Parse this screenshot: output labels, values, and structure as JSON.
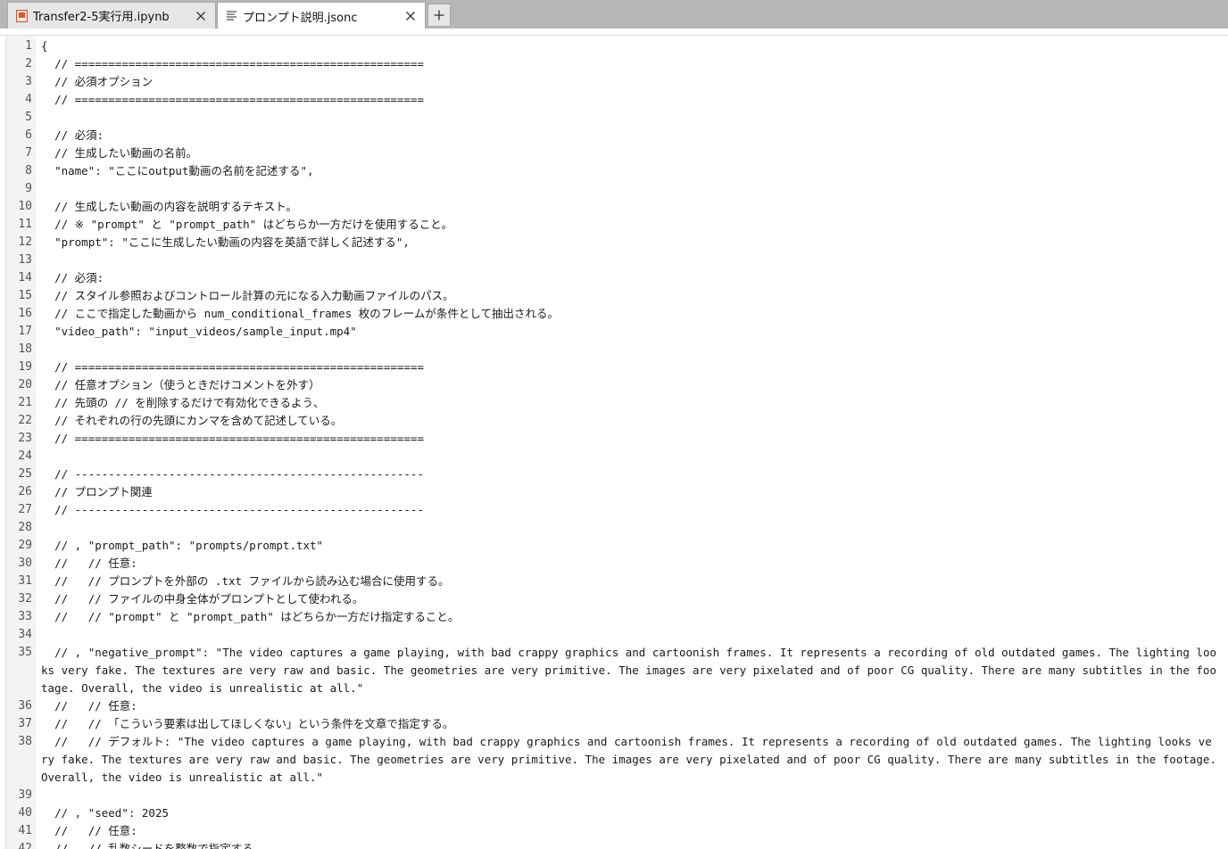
{
  "tabs": [
    {
      "label": "Transfer2-5実行用.ipynb",
      "icon": "notebook-icon",
      "active": false
    },
    {
      "label": "プロンプト説明.jsonc",
      "icon": "text-file-icon",
      "active": true
    }
  ],
  "add_tab_label": "+",
  "close_glyph": "✕",
  "colors": {
    "notebook_icon": "#e8542c",
    "tabbar_bg": "#b7b7b7",
    "gutter_bg": "#f3f3f3"
  },
  "editor": {
    "lines": [
      {
        "n": "1",
        "text": "{"
      },
      {
        "n": "2",
        "text": "  // ===================================================="
      },
      {
        "n": "3",
        "text": "  // 必須オプション"
      },
      {
        "n": "4",
        "text": "  // ===================================================="
      },
      {
        "n": "5",
        "text": ""
      },
      {
        "n": "6",
        "text": "  // 必須:"
      },
      {
        "n": "7",
        "text": "  // 生成したい動画の名前。"
      },
      {
        "n": "8",
        "text": "  \"name\": \"ここにoutput動画の名前を記述する\","
      },
      {
        "n": "9",
        "text": ""
      },
      {
        "n": "10",
        "text": "  // 生成したい動画の内容を説明するテキスト。"
      },
      {
        "n": "11",
        "text": "  // ※ \"prompt\" と \"prompt_path\" はどちらか一方だけを使用すること。"
      },
      {
        "n": "12",
        "text": "  \"prompt\": \"ここに生成したい動画の内容を英語で詳しく記述する\","
      },
      {
        "n": "13",
        "text": ""
      },
      {
        "n": "14",
        "text": "  // 必須:"
      },
      {
        "n": "15",
        "text": "  // スタイル参照およびコントロール計算の元になる入力動画ファイルのパス。"
      },
      {
        "n": "16",
        "text": "  // ここで指定した動画から num_conditional_frames 枚のフレームが条件として抽出される。"
      },
      {
        "n": "17",
        "text": "  \"video_path\": \"input_videos/sample_input.mp4\""
      },
      {
        "n": "18",
        "text": ""
      },
      {
        "n": "19",
        "text": "  // ===================================================="
      },
      {
        "n": "20",
        "text": "  // 任意オプション（使うときだけコメントを外す）"
      },
      {
        "n": "21",
        "text": "  // 先頭の // を削除するだけで有効化できるよう、"
      },
      {
        "n": "22",
        "text": "  // それぞれの行の先頭にカンマを含めて記述している。"
      },
      {
        "n": "23",
        "text": "  // ===================================================="
      },
      {
        "n": "24",
        "text": ""
      },
      {
        "n": "25",
        "text": "  // ----------------------------------------------------"
      },
      {
        "n": "26",
        "text": "  // プロンプト関連"
      },
      {
        "n": "27",
        "text": "  // ----------------------------------------------------"
      },
      {
        "n": "28",
        "text": ""
      },
      {
        "n": "29",
        "text": "  // , \"prompt_path\": \"prompts/prompt.txt\""
      },
      {
        "n": "30",
        "text": "  //   // 任意:"
      },
      {
        "n": "31",
        "text": "  //   // プロンプトを外部の .txt ファイルから読み込む場合に使用する。"
      },
      {
        "n": "32",
        "text": "  //   // ファイルの中身全体がプロンプトとして使われる。"
      },
      {
        "n": "33",
        "text": "  //   // \"prompt\" と \"prompt_path\" はどちらか一方だけ指定すること。"
      },
      {
        "n": "34",
        "text": ""
      },
      {
        "n": "35",
        "text": "  // , \"negative_prompt\": \"The video captures a game playing, with bad crappy graphics and cartoonish frames. It represents a recording of old outdated games. The lighting looks very fake. The textures are very raw and basic. The geometries are very primitive. The images are very pixelated and of poor CG quality. There are many subtitles in the footage. Overall, the video is unrealistic at all.\""
      },
      {
        "n": "36",
        "text": "  //   // 任意:"
      },
      {
        "n": "37",
        "text": "  //   // 「こういう要素は出してほしくない」という条件を文章で指定する。"
      },
      {
        "n": "38",
        "text": "  //   // デフォルト: \"The video captures a game playing, with bad crappy graphics and cartoonish frames. It represents a recording of old outdated games. The lighting looks very fake. The textures are very raw and basic. The geometries are very primitive. The images are very pixelated and of poor CG quality. There are many subtitles in the footage. Overall, the video is unrealistic at all.\""
      },
      {
        "n": "39",
        "text": ""
      },
      {
        "n": "40",
        "text": "  // , \"seed\": 2025"
      },
      {
        "n": "41",
        "text": "  //   // 任意:"
      },
      {
        "n": "42",
        "text": "  //   // 乱数シードを整数で指定する。"
      }
    ]
  }
}
